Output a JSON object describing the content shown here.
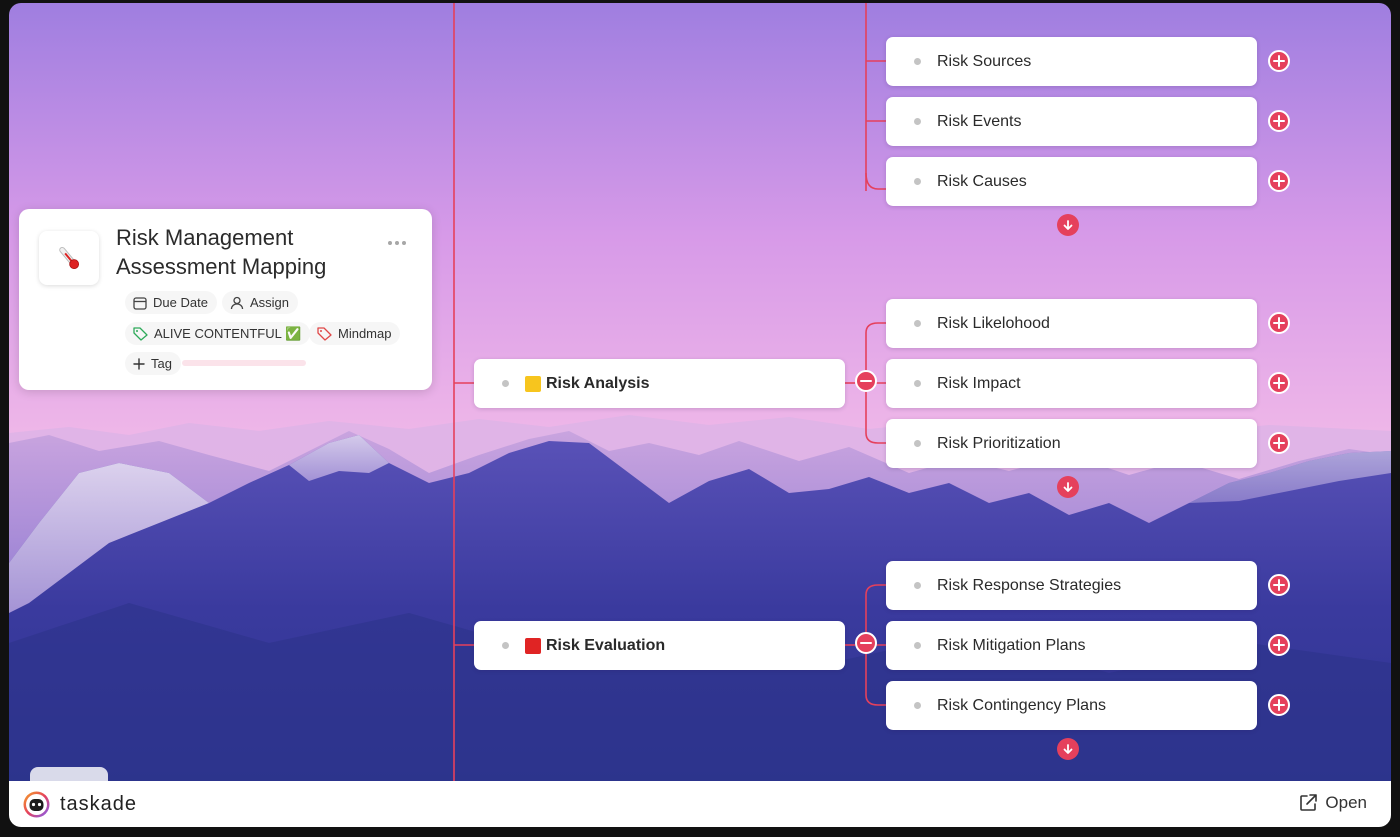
{
  "project": {
    "title": "Risk Management Assessment Mapping",
    "icon": "thermometer-icon",
    "due_date_label": "Due Date",
    "assign_label": "Assign",
    "tags": [
      "ALIVE CONTENTFUL ✅",
      "Mindmap"
    ],
    "add_tag_label": "Tag"
  },
  "mindmap": {
    "accent_color": "#e5405c",
    "groups": [
      {
        "label": "",
        "children": [
          "Risk Sources",
          "Risk Events",
          "Risk Causes"
        ]
      },
      {
        "label": "Risk Analysis",
        "color": "#f7c51e",
        "children": [
          "Risk Likelohood",
          "Risk Impact",
          "Risk Prioritization"
        ]
      },
      {
        "label": "Risk Evaluation",
        "color": "#e02424",
        "children": [
          "Risk Response Strategies",
          "Risk Mitigation Plans",
          "Risk Contingency Plans"
        ]
      }
    ]
  },
  "footer": {
    "brand": "taskade",
    "open_label": "Open"
  }
}
